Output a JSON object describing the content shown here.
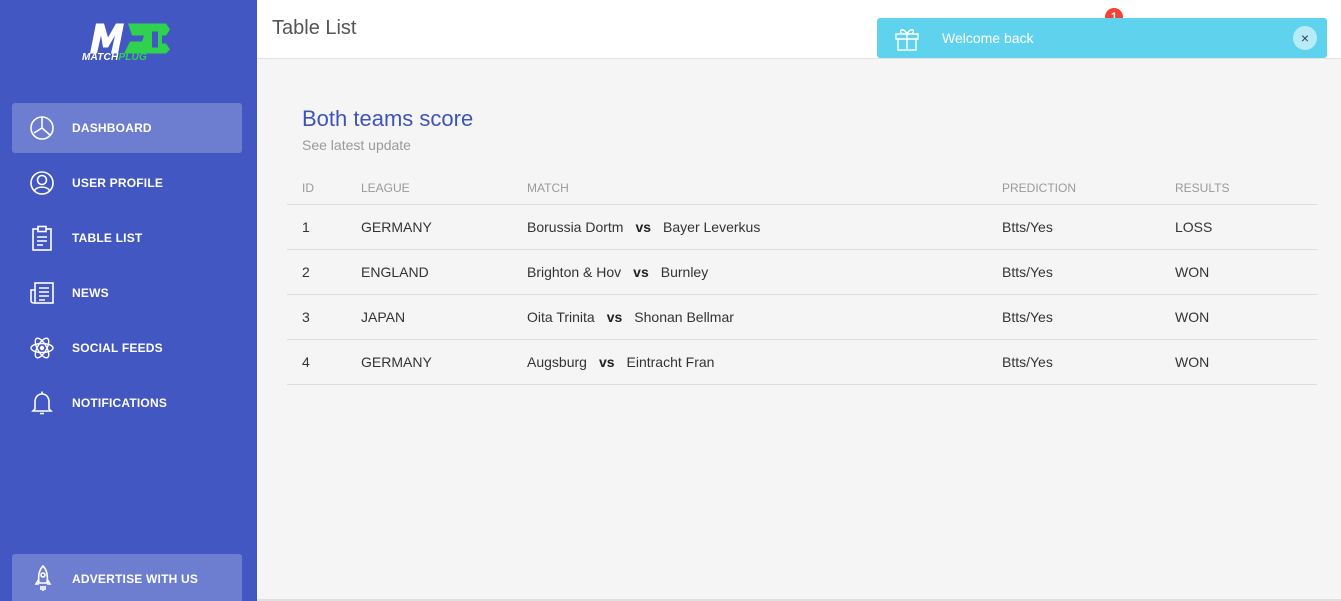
{
  "brand": {
    "logo_initials": "MP",
    "name_prefix": "MATCH",
    "name_suffix": "PLUG",
    "accent": "#2fd14f"
  },
  "colors": {
    "sidebar": "#4257c2",
    "toast": "#5fd2ee",
    "title": "#3f55b5",
    "badge": "#f44336"
  },
  "sidebar": {
    "items": [
      {
        "label": "DASHBOARD",
        "icon": "pie-chart-icon",
        "active": true
      },
      {
        "label": "USER PROFILE",
        "icon": "user-icon",
        "active": false
      },
      {
        "label": "TABLE LIST",
        "icon": "clipboard-icon",
        "active": false
      },
      {
        "label": "NEWS",
        "icon": "newspaper-icon",
        "active": false
      },
      {
        "label": "SOCIAL FEEDS",
        "icon": "atom-icon",
        "active": false
      },
      {
        "label": "NOTIFICATIONS",
        "icon": "bell-icon",
        "active": false
      }
    ],
    "advertise": {
      "label": "ADVERTISE WITH US",
      "icon": "rocket-icon"
    }
  },
  "header": {
    "title": "Table List",
    "notification_count": "1"
  },
  "toast": {
    "message": "Welcome back",
    "icon": "gift-icon",
    "close": "×"
  },
  "card": {
    "title": "Both teams score",
    "subtitle": "See latest update",
    "columns": [
      "ID",
      "LEAGUE",
      "MATCH",
      "PREDICTION",
      "RESULTS"
    ],
    "vs_label": "vs",
    "rows": [
      {
        "id": "1",
        "league": "GERMANY",
        "home": "Borussia Dortm",
        "away": "Bayer Leverkus",
        "prediction": "Btts/Yes",
        "result": "LOSS"
      },
      {
        "id": "2",
        "league": "ENGLAND",
        "home": "Brighton & Hov",
        "away": "Burnley",
        "prediction": "Btts/Yes",
        "result": "WON"
      },
      {
        "id": "3",
        "league": "JAPAN",
        "home": "Oita Trinita",
        "away": "Shonan Bellmar",
        "prediction": "Btts/Yes",
        "result": "WON"
      },
      {
        "id": "4",
        "league": "GERMANY",
        "home": "Augsburg",
        "away": "Eintracht Fran",
        "prediction": "Btts/Yes",
        "result": "WON"
      }
    ]
  }
}
